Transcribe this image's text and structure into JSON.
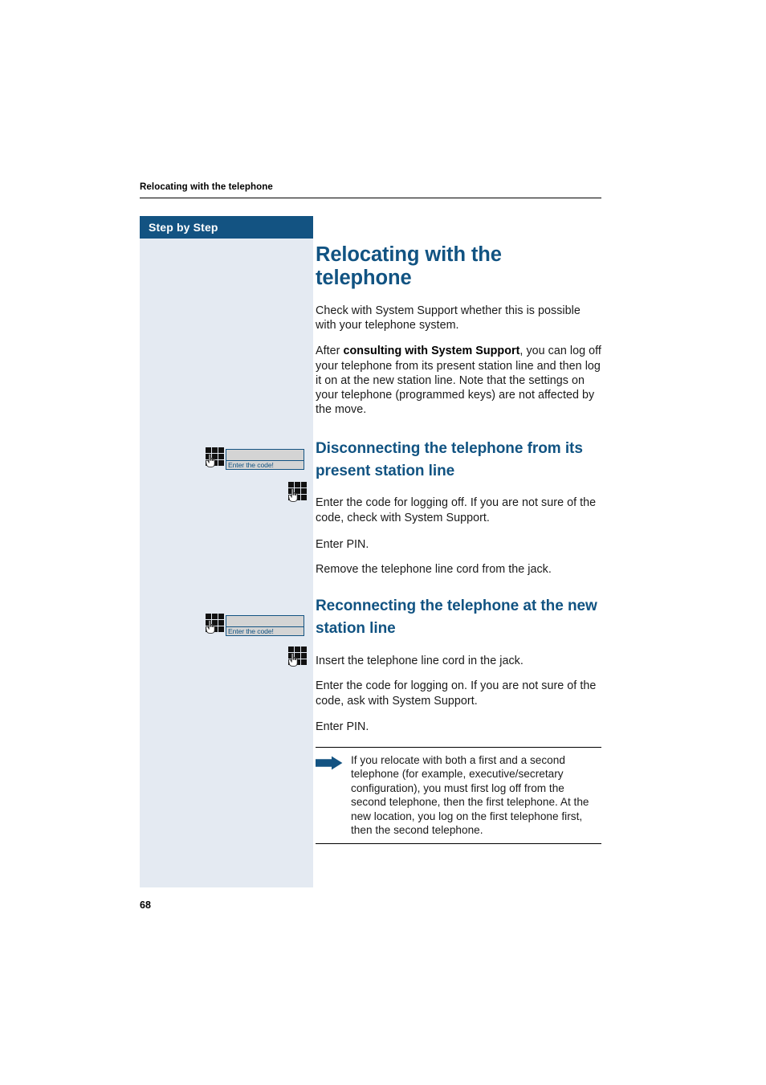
{
  "page": {
    "running_header": "Relocating with the telephone",
    "folio": "68",
    "colors": {
      "accent_blue": "#115382",
      "step_panel_bg": "#e4eaf2",
      "step_header_bg": "#135382",
      "display_bg": "#d4d4d4",
      "body_text": "#1a1a1a"
    }
  },
  "step_column": {
    "header_label": "Step by Step"
  },
  "main": {
    "title": "Relocating with the telephone",
    "intro_paragraphs": [
      "Check with System Support whether this is possible with your telephone system.",
      "After consulting with System Support, you can log off your telephone from its present station line and then log it on at the new station line. Note that the settings on your telephone (programmed keys) are not affected by the move."
    ],
    "intro_bold_run": "consulting with System Support",
    "intro_par2_prefix": "After ",
    "intro_par2_suffix": ", you can log off your telephone from its present station line and then log it on at the new station line. Note that the settings on your telephone (programmed keys) are not affected by the move.",
    "sections": [
      {
        "heading": "Disconnecting the telephone from its present station line",
        "steps": [
          {
            "gutter": "keypad-with-display",
            "display_text": "Enter the code!",
            "text": "Enter the code for logging off. If you are not sure of the code, check with System Support."
          },
          {
            "gutter": "keypad",
            "text": "Enter PIN."
          },
          {
            "gutter": "none",
            "text": "Remove the telephone line cord from the jack."
          }
        ]
      },
      {
        "heading": "Reconnecting the telephone at the new station line",
        "steps": [
          {
            "gutter": "none",
            "text": "Insert the telephone line cord in the jack."
          },
          {
            "gutter": "keypad-with-display",
            "display_text": "Enter the code!",
            "text": "Enter the code for logging on. If you are not sure of the code, ask with System Support."
          },
          {
            "gutter": "keypad",
            "text": "Enter PIN."
          }
        ]
      }
    ],
    "note": {
      "icon": "right-arrow-icon",
      "text": "If you relocate with both a first and a second telephone (for example, executive/secretary configuration), you must first log off from the second telephone, then the first telephone. At the new location, you log on the first telephone first, then the second telephone."
    }
  }
}
